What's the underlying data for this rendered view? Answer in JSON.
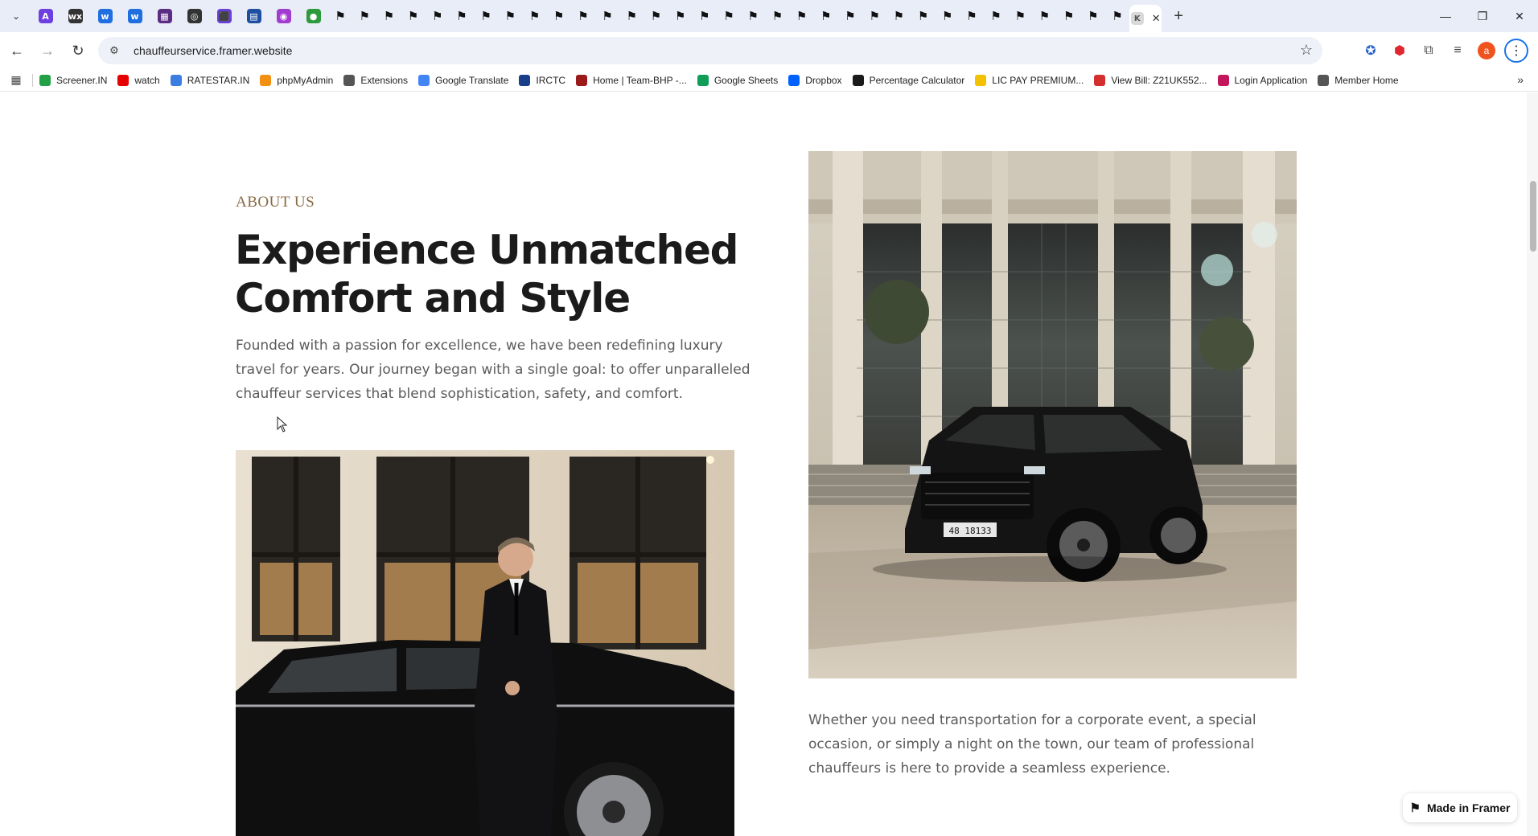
{
  "browser": {
    "url": "chauffeurservice.framer.website",
    "pinned_tabs": [
      {
        "icon": "tab-search-icon",
        "glyph": "⌄"
      },
      {
        "icon": "purple-a-icon",
        "glyph": "A",
        "color": "#6d3fe0"
      },
      {
        "icon": "wix-icon",
        "glyph": "wx",
        "color": "#333333"
      },
      {
        "icon": "blue-w-icon",
        "glyph": "w",
        "color": "#1f6fe0"
      },
      {
        "icon": "blue-w-icon",
        "glyph": "w",
        "color": "#1f6fe0"
      },
      {
        "icon": "film-icon",
        "glyph": "▦",
        "color": "#5a2d82"
      },
      {
        "icon": "spiral-icon",
        "glyph": "◎",
        "color": "#333333"
      },
      {
        "icon": "purple-square-icon",
        "glyph": "⬛",
        "color": "#6a3fd6"
      },
      {
        "icon": "calendar-icon",
        "glyph": "▤",
        "color": "#1d4ea0"
      },
      {
        "icon": "pink-circle-icon",
        "glyph": "◉",
        "color": "#a23bd0"
      },
      {
        "icon": "green-leaf-icon",
        "glyph": "●",
        "color": "#2e9a3e"
      }
    ],
    "framer_tab_count": 33,
    "active_tab_favicon": "K",
    "bookmarks": [
      {
        "label": "Screener.IN",
        "icon": "bar-chart-icon",
        "color": "#22a045"
      },
      {
        "label": "watch",
        "icon": "youtube-icon",
        "color": "#e60000"
      },
      {
        "label": "RATESTAR.IN",
        "icon": "star-icon",
        "color": "#3b7de0"
      },
      {
        "label": "phpMyAdmin",
        "icon": "phpmyadmin-icon",
        "color": "#f29111"
      },
      {
        "label": "Extensions",
        "icon": "puzzle-icon",
        "color": "#555555"
      },
      {
        "label": "Google Translate",
        "icon": "translate-icon",
        "color": "#4285f4"
      },
      {
        "label": "IRCTC",
        "icon": "train-icon",
        "color": "#1a3f8a"
      },
      {
        "label": "Home | Team-BHP -...",
        "icon": "teambhp-icon",
        "color": "#9b1b1b"
      },
      {
        "label": "Google Sheets",
        "icon": "sheets-icon",
        "color": "#0f9d58"
      },
      {
        "label": "Dropbox",
        "icon": "dropbox-icon",
        "color": "#0061ff"
      },
      {
        "label": "Percentage Calculator",
        "icon": "percent-icon",
        "color": "#1a1a1a"
      },
      {
        "label": "LIC PAY PREMIUM...",
        "icon": "lic-icon",
        "color": "#f2c200"
      },
      {
        "label": "View Bill: Z21UK552...",
        "icon": "bill-icon",
        "color": "#d32f2f"
      },
      {
        "label": "Login Application",
        "icon": "login-icon",
        "color": "#c2185b"
      },
      {
        "label": "Member Home",
        "icon": "globe-icon",
        "color": "#555555"
      }
    ]
  },
  "page": {
    "eyebrow": "ABOUT US",
    "headline": "Experience Unmatched Comfort and Style",
    "intro": "Founded with a passion for excellence, we have been redefining luxury travel for years. Our journey began with a single goal: to offer unparalleled chauffeur services that blend sophistication, safety, and comfort.",
    "body": "Whether you need transportation for a corporate event, a special occasion, or simply a night on the town, our team of professional chauffeurs is here to provide a seamless experience.",
    "car_plate": "48 18133",
    "badge": "Made in Framer"
  }
}
